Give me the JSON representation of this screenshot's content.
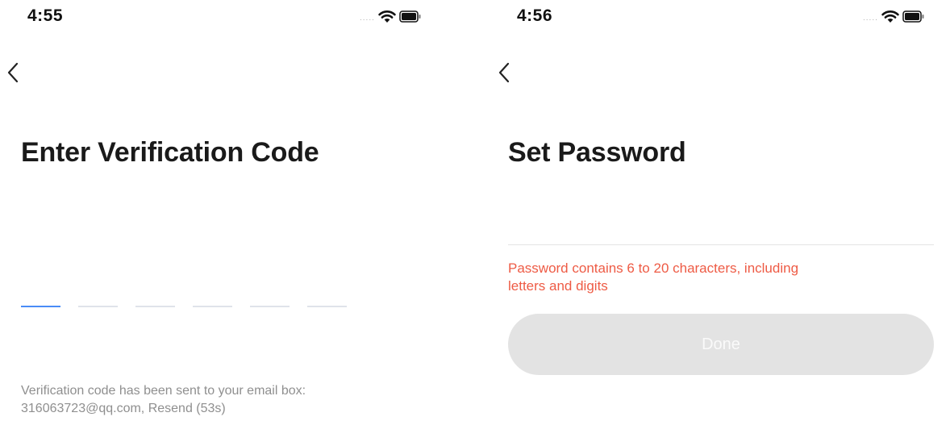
{
  "left": {
    "status_bar": {
      "time": "4:55",
      "signal": ".....",
      "signal_icon": "signal-dots-icon",
      "wifi_icon": "wifi-icon",
      "battery_icon": "battery-icon"
    },
    "back_icon": "chevron-left-icon",
    "title": "Enter Verification Code",
    "code": {
      "length": 6,
      "active_index": 0,
      "values": [
        "",
        "",
        "",
        "",
        "",
        ""
      ]
    },
    "hint": {
      "line1": "Verification code has been sent to your email box:",
      "line2": "316063723@qq.com, Resend (53s)"
    },
    "colors": {
      "active_underline": "#4a8cf7",
      "inactive_underline": "#dfe3ea",
      "hint": "#8f8f8f"
    }
  },
  "right": {
    "status_bar": {
      "time": "4:56",
      "signal": ".....",
      "signal_icon": "signal-dots-icon",
      "wifi_icon": "wifi-icon",
      "battery_icon": "battery-icon"
    },
    "back_icon": "chevron-left-icon",
    "title": "Set Password",
    "password": {
      "value": "",
      "placeholder": ""
    },
    "error": {
      "line1": "Password contains 6 to 20 characters, including",
      "line2": "letters and digits"
    },
    "done_button": {
      "label": "Done",
      "state": "disabled"
    },
    "colors": {
      "error": "#ee5b45",
      "button_bg": "#e3e3e3",
      "button_text": "#fafafa"
    }
  }
}
